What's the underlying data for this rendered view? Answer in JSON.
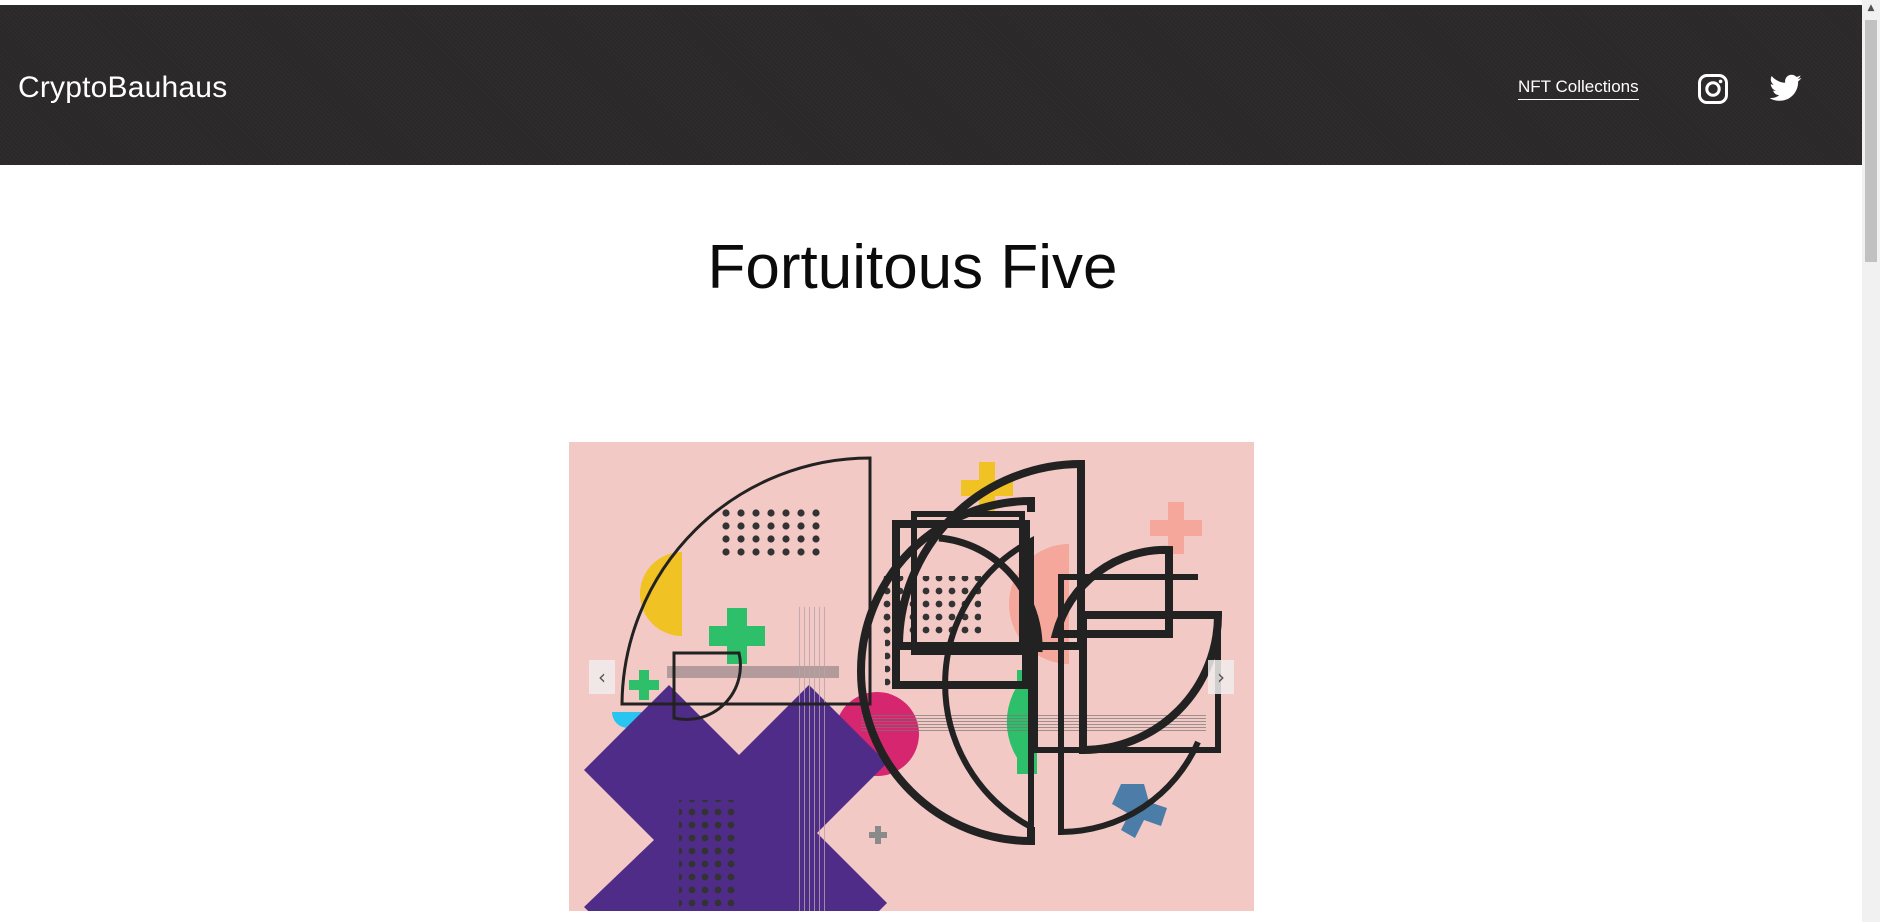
{
  "header": {
    "brand": "CryptoBauhaus",
    "nav_link": "NFT Collections",
    "social": [
      "instagram-icon",
      "twitter-icon"
    ]
  },
  "page": {
    "title": "Fortuitous Five"
  },
  "slider": {
    "prev_symbol": "‹",
    "next_symbol": "›",
    "artwork_colors": {
      "background": "#f3c9c6",
      "purple": "#4f2c88",
      "green": "#2dbf6a",
      "yellow": "#f0c223",
      "magenta": "#d6266f",
      "cyan": "#29c4f0",
      "salmon": "#f5a79c",
      "steel_blue": "#4b7da8",
      "ink": "#222222"
    }
  },
  "colors": {
    "header_bg": "#2a2828",
    "header_text": "#ffffff",
    "page_bg": "#ffffff"
  }
}
